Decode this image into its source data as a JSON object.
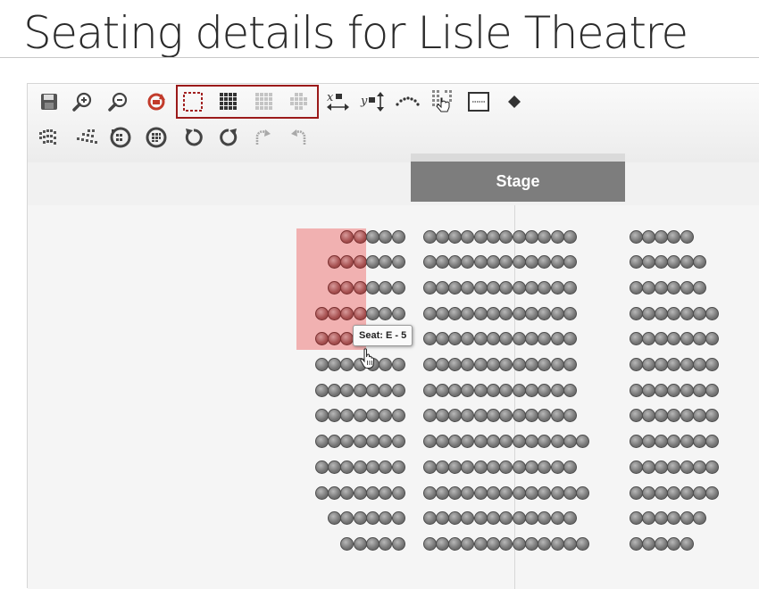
{
  "page": {
    "title": "Seating details for Lisle Theatre"
  },
  "toolbar": {
    "row1": [
      "save-icon",
      "zoom-in-icon",
      "zoom-out-icon",
      "reset-icon",
      "select-rectangle-icon",
      "select-grid-icon",
      "select-grid-light-icon",
      "select-partial-icon",
      "x-axis-lock-icon",
      "y-axis-lock-icon",
      "curve-icon",
      "seat-select-icon",
      "label-box-icon",
      "diamond-icon"
    ],
    "row2": [
      "seats-cluster-icon",
      "seats-arc-icon",
      "rotate-group-left-icon",
      "rotate-group-right-icon",
      "rotate-left-icon",
      "rotate-right-icon",
      "redo-faded-icon",
      "undo-faded-icon"
    ],
    "x_axis_label": "x",
    "y_axis_label": "y"
  },
  "stage": {
    "label": "Stage"
  },
  "tooltip": {
    "text": "Seat: E - 5"
  },
  "seating": {
    "selected_rows": 5,
    "selected_seats_per_row": 4,
    "sections": [
      {
        "name": "left",
        "rows": [
          5,
          6,
          6,
          7,
          7,
          7,
          7,
          7,
          7,
          7,
          7,
          6,
          5
        ]
      },
      {
        "name": "center",
        "rows": [
          12,
          12,
          12,
          12,
          12,
          12,
          12,
          12,
          13,
          12,
          13,
          12,
          13
        ]
      },
      {
        "name": "right",
        "rows": [
          5,
          6,
          6,
          7,
          7,
          7,
          7,
          7,
          7,
          7,
          7,
          6,
          5
        ]
      }
    ]
  },
  "colors": {
    "accent": "#9b1a1a",
    "selection": "#ec7878",
    "stage": "#7d7d7d",
    "seat": "#757575"
  }
}
